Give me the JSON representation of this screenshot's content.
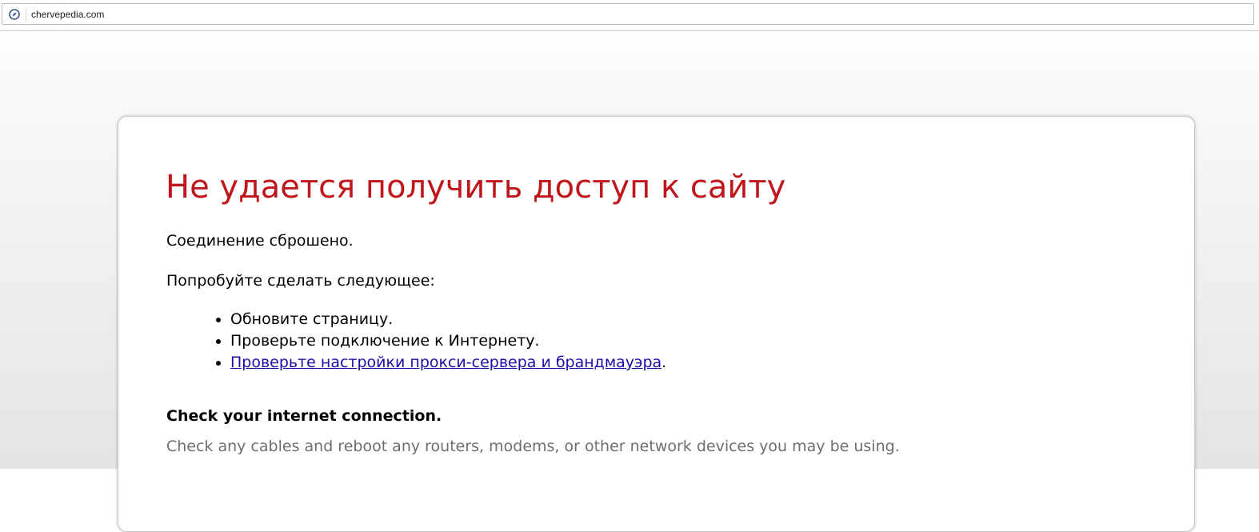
{
  "browser": {
    "url": "chervepedia.com",
    "site_icon": "info-circle-icon"
  },
  "error": {
    "title": "Не удается получить доступ к сайту",
    "message": "Соединение сброшено.",
    "try_label": "Попробуйте сделать следующее:",
    "suggestions": [
      {
        "text": "Обновите страницу."
      },
      {
        "text": "Проверьте подключение к Интернету."
      },
      {
        "link_text": "Проверьте настройки прокси-сервера и брандмауэра",
        "suffix": "."
      }
    ],
    "heading": "Check your internet connection.",
    "description": "Check any cables and reboot any routers, modems, or other network devices you may be using."
  },
  "colors": {
    "title": "#c0161b",
    "link": "#1a0dab",
    "muted_text": "#6e6e6e"
  }
}
